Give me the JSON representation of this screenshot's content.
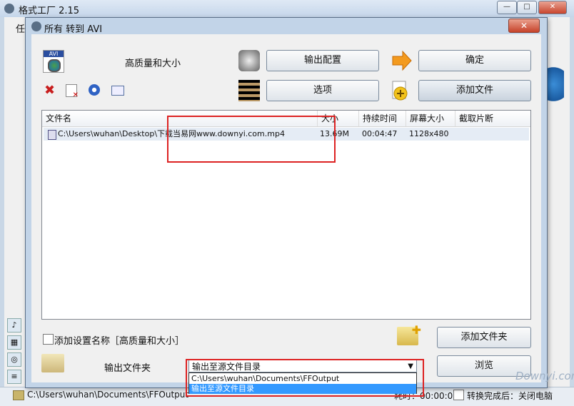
{
  "app": {
    "title": "格式工厂 2.15",
    "menu_partial": "任",
    "window_buttons": {
      "minimize": "—",
      "maximize": "□",
      "close": "✕"
    },
    "status": {
      "path": "C:\\Users\\wuhan\\Documents\\FFOutput",
      "elapsed": "耗时：00:00:00",
      "after_done": "转换完成后：关闭电脑"
    }
  },
  "dialog": {
    "title": "所有 转到 AVI",
    "close": "✕",
    "quality": "高质量和大小",
    "buttons": {
      "config": "输出配置",
      "ok": "确定",
      "options": "选项",
      "add_file": "添加文件",
      "add_folder": "添加文件夹",
      "browse": "浏览"
    },
    "file_list": {
      "columns": [
        "文件名",
        "大小",
        "持续时间",
        "屏幕大小",
        "截取片断"
      ],
      "rows": [
        {
          "name": "C:\\Users\\wuhan\\Desktop\\下载当易网www.downyi.com.mp4",
          "size": "13.69M",
          "duration": "00:04:47",
          "screen": "1128x480",
          "clip": ""
        }
      ]
    },
    "add_setting_name": "添加设置名称［高质量和大小］",
    "output_folder_label": "输出文件夹",
    "output_select": {
      "value": "输出至源文件目录",
      "options": [
        "C:\\Users\\wuhan\\Documents\\FFOutput",
        "输出至源文件目录"
      ]
    }
  },
  "watermark": "Downyi.com",
  "colors": {
    "highlight_box": "#dd2222",
    "selected_option": "#3399ff"
  }
}
